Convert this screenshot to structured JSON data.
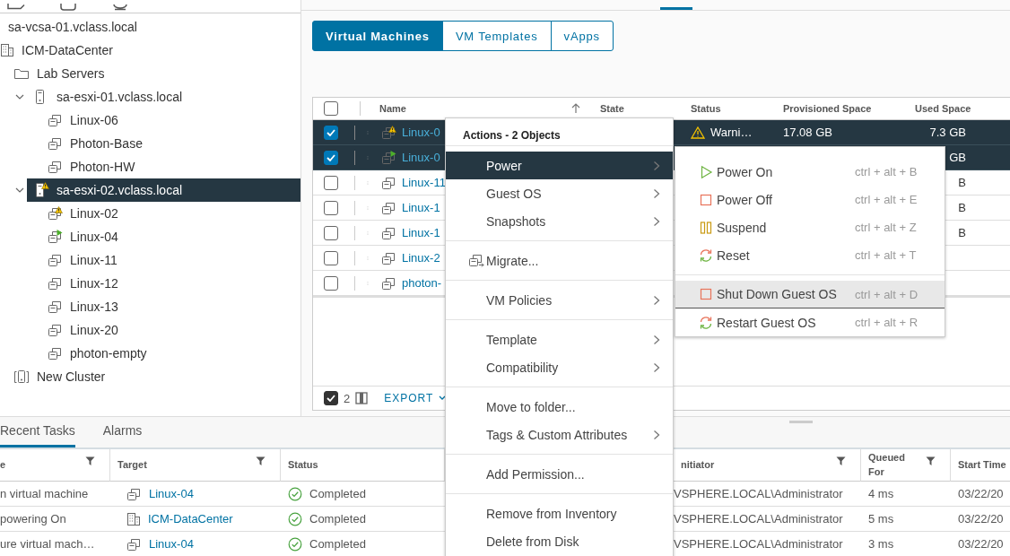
{
  "tree": [
    {
      "label": "sa-vcsa-01.vclass.local",
      "selected": false,
      "children": [
        {
          "label": "ICM-DataCenter",
          "kind": "datacenter",
          "selected": false,
          "children": [
            {
              "label": "Lab Servers",
              "kind": "folder",
              "selected": false,
              "children": [
                {
                  "label": "sa-esxi-01.vclass.local",
                  "kind": "host",
                  "warning": false,
                  "expanded": true,
                  "selected": false,
                  "children": [
                    {
                      "label": "Linux-06",
                      "kind": "vm",
                      "warning": false,
                      "powered_on": false,
                      "selected": false
                    },
                    {
                      "label": "Photon-Base",
                      "kind": "vm",
                      "warning": false,
                      "powered_on": false,
                      "selected": false
                    },
                    {
                      "label": "Photon-HW",
                      "kind": "vm",
                      "warning": false,
                      "powered_on": false,
                      "selected": false
                    }
                  ]
                },
                {
                  "label": "sa-esxi-02.vclass.local",
                  "kind": "host",
                  "warning": true,
                  "expanded": true,
                  "selected": true,
                  "children": [
                    {
                      "label": "Linux-02",
                      "kind": "vm",
                      "warning": true,
                      "powered_on": false,
                      "selected": false
                    },
                    {
                      "label": "Linux-04",
                      "kind": "vm",
                      "warning": false,
                      "powered_on": true,
                      "selected": false
                    },
                    {
                      "label": "Linux-11",
                      "kind": "vm",
                      "warning": false,
                      "powered_on": false,
                      "selected": false
                    },
                    {
                      "label": "Linux-12",
                      "kind": "vm",
                      "warning": false,
                      "powered_on": false,
                      "selected": false
                    },
                    {
                      "label": "Linux-13",
                      "kind": "vm",
                      "warning": false,
                      "powered_on": false,
                      "selected": false
                    },
                    {
                      "label": "Linux-20",
                      "kind": "vm",
                      "warning": false,
                      "powered_on": false,
                      "selected": false
                    },
                    {
                      "label": "photon-empty",
                      "kind": "vm",
                      "warning": false,
                      "powered_on": false,
                      "selected": false
                    }
                  ]
                }
              ]
            },
            {
              "label": "New Cluster",
              "kind": "cluster",
              "selected": false
            }
          ]
        }
      ]
    }
  ],
  "subtabs": [
    {
      "label": "Virtual Machines",
      "selected": true
    },
    {
      "label": "VM Templates",
      "selected": false
    },
    {
      "label": "vApps",
      "selected": false
    }
  ],
  "vm_table": {
    "all_checked": false,
    "columns": [
      {
        "label": "Name",
        "sorted": true
      },
      {
        "label": "State",
        "sorted": false
      },
      {
        "label": "Status",
        "sorted": false
      },
      {
        "label": "Provisioned Space",
        "sorted": false
      },
      {
        "label": "Used Space",
        "sorted": false
      }
    ],
    "rows": [
      {
        "selected": true,
        "warning": true,
        "powered_on": false,
        "name": "Linux-0",
        "status_text": "Warni…",
        "provisioned": "17.08 GB",
        "used": "7.3 GB"
      },
      {
        "selected": true,
        "warning": false,
        "powered_on": true,
        "name": "Linux-0",
        "used": "GB"
      },
      {
        "selected": false,
        "warning": false,
        "powered_on": false,
        "name": "Linux-11",
        "used": "B"
      },
      {
        "selected": false,
        "warning": false,
        "powered_on": false,
        "name": "Linux-1",
        "used": "B"
      },
      {
        "selected": false,
        "warning": false,
        "powered_on": false,
        "name": "Linux-1",
        "used": "B"
      },
      {
        "selected": false,
        "warning": false,
        "powered_on": false,
        "name": "Linux-2"
      },
      {
        "selected": false,
        "warning": false,
        "powered_on": false,
        "name": "photon-"
      }
    ],
    "footer": {
      "all_checked": true,
      "count": "2",
      "export": "EXPORT"
    }
  },
  "actions_menu": {
    "title": "Actions - 2 Objects",
    "sections": [
      [
        {
          "label": "Power",
          "kind": "submenu",
          "selected": true
        },
        {
          "label": "Guest OS",
          "kind": "submenu",
          "selected": false
        },
        {
          "label": "Snapshots",
          "kind": "submenu",
          "selected": false
        }
      ],
      [
        {
          "label": "Migrate...",
          "kind": "migrate",
          "selected": false
        }
      ],
      [
        {
          "label": "VM Policies",
          "kind": "submenu",
          "selected": false
        }
      ],
      [
        {
          "label": "Template",
          "kind": "submenu",
          "selected": false
        },
        {
          "label": "Compatibility",
          "kind": "submenu",
          "selected": false
        }
      ],
      [
        {
          "label": "Move to folder...",
          "kind": "plain",
          "selected": false
        },
        {
          "label": "Tags & Custom Attributes",
          "kind": "submenu",
          "selected": false
        }
      ],
      [
        {
          "label": "Add Permission...",
          "kind": "plain",
          "selected": false
        }
      ],
      [
        {
          "label": "Remove from Inventory",
          "kind": "plain",
          "selected": false
        },
        {
          "label": "Delete from Disk",
          "kind": "plain",
          "selected": false
        }
      ]
    ]
  },
  "power_menu": {
    "sections": [
      [
        {
          "label": "Power On",
          "kind": "play",
          "shortcut": "ctrl + alt + B",
          "selected": false
        },
        {
          "label": "Power Off",
          "kind": "stop",
          "shortcut": "ctrl + alt + E",
          "selected": false
        },
        {
          "label": "Suspend",
          "kind": "pause",
          "shortcut": "ctrl + alt + Z",
          "selected": false
        },
        {
          "label": "Reset",
          "kind": "reset",
          "shortcut": "ctrl + alt + T",
          "selected": false
        }
      ],
      [
        {
          "label": "Shut Down Guest OS",
          "kind": "stop",
          "shortcut": "ctrl + alt + D",
          "selected": true
        },
        {
          "label": "Restart Guest OS",
          "kind": "reset",
          "shortcut": "ctrl + alt + R",
          "selected": false
        }
      ]
    ]
  },
  "bottom_tabs": [
    {
      "label": "Recent Tasks",
      "selected": true
    },
    {
      "label": "Alarms",
      "selected": false
    }
  ],
  "tasks": {
    "columns": [
      {
        "label": "e",
        "filter": true
      },
      {
        "label": "Target",
        "filter": true
      },
      {
        "label": "Status",
        "filter": false
      },
      {
        "label": "nitiator",
        "filter": true
      },
      {
        "label": "Queued For",
        "filter": true
      },
      {
        "label": "Start Time",
        "filter": false
      }
    ],
    "rows": [
      {
        "task": "n virtual machine",
        "kind": "vm",
        "target": "Linux-04",
        "status": "Completed",
        "initiator": "VSPHERE.LOCAL\\Administrator",
        "queued": "4 ms",
        "start": "03/22/20"
      },
      {
        "task": "powering On",
        "kind": "datacenter",
        "target": "ICM-DataCenter",
        "status": "Completed",
        "initiator": "VSPHERE.LOCAL\\Administrator",
        "queued": "5 ms",
        "start": "03/22/20"
      },
      {
        "task": "ure virtual mach…",
        "kind": "vm",
        "target": "Linux-04",
        "status": "Completed",
        "initiator": "VSPHERE.LOCAL\\Administrator",
        "queued": "3 ms",
        "start": "03/22/20"
      }
    ]
  }
}
